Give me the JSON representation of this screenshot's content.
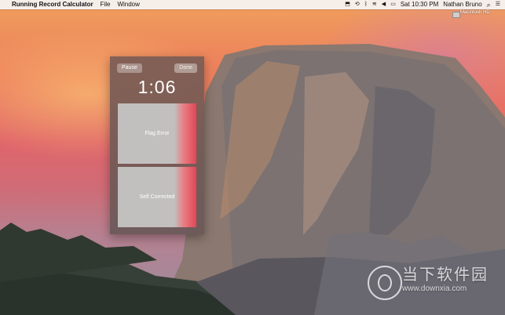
{
  "menubar": {
    "app_name": "Running Record Calculator",
    "menu_items": [
      "File",
      "Window"
    ],
    "status_time": "Sat 10:30 PM",
    "user": "Nathan Bruno"
  },
  "desktop": {
    "drive_label": "Macintosh HD"
  },
  "window": {
    "pause_label": "Pause",
    "done_label": "Done",
    "timer": "1:06",
    "flag_error_label": "Flag Error",
    "self_corrected_label": "Self Corrected"
  },
  "watermark": {
    "brand": "当下软件园",
    "url": "www.downxia.com"
  },
  "colors": {
    "menubar_bg": "#f5f5f5",
    "window_bg": "#7a5c54",
    "panel_gray": "#c2c0be",
    "panel_accent": "#e04656"
  }
}
